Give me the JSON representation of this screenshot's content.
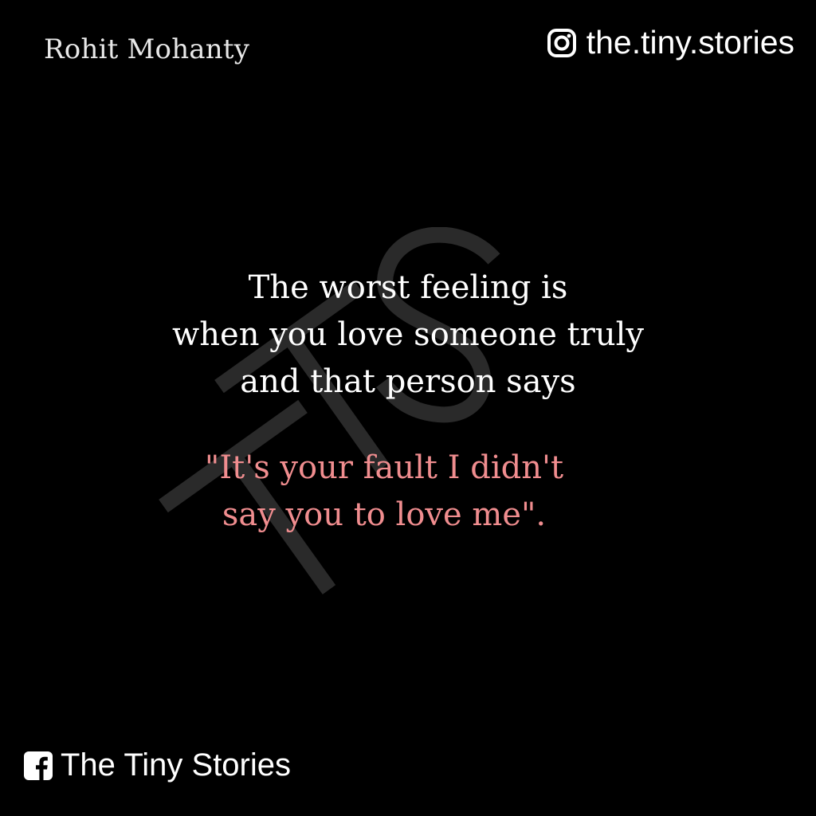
{
  "author": "Rohit Mohanty",
  "instagram": {
    "icon": "instagram-icon",
    "handle": "the.tiny.stories"
  },
  "watermark": {
    "text": "TTS",
    "color": "#2a2a2a"
  },
  "quote": {
    "lines": [
      "The worst feeling is",
      "when you love someone truly",
      "and that person says"
    ]
  },
  "reply": {
    "color": "#f08d8f",
    "lines": [
      "\"It's your fault I didn't",
      "say you to love me\"."
    ]
  },
  "facebook": {
    "icon": "facebook-icon",
    "name": "The Tiny Stories"
  }
}
